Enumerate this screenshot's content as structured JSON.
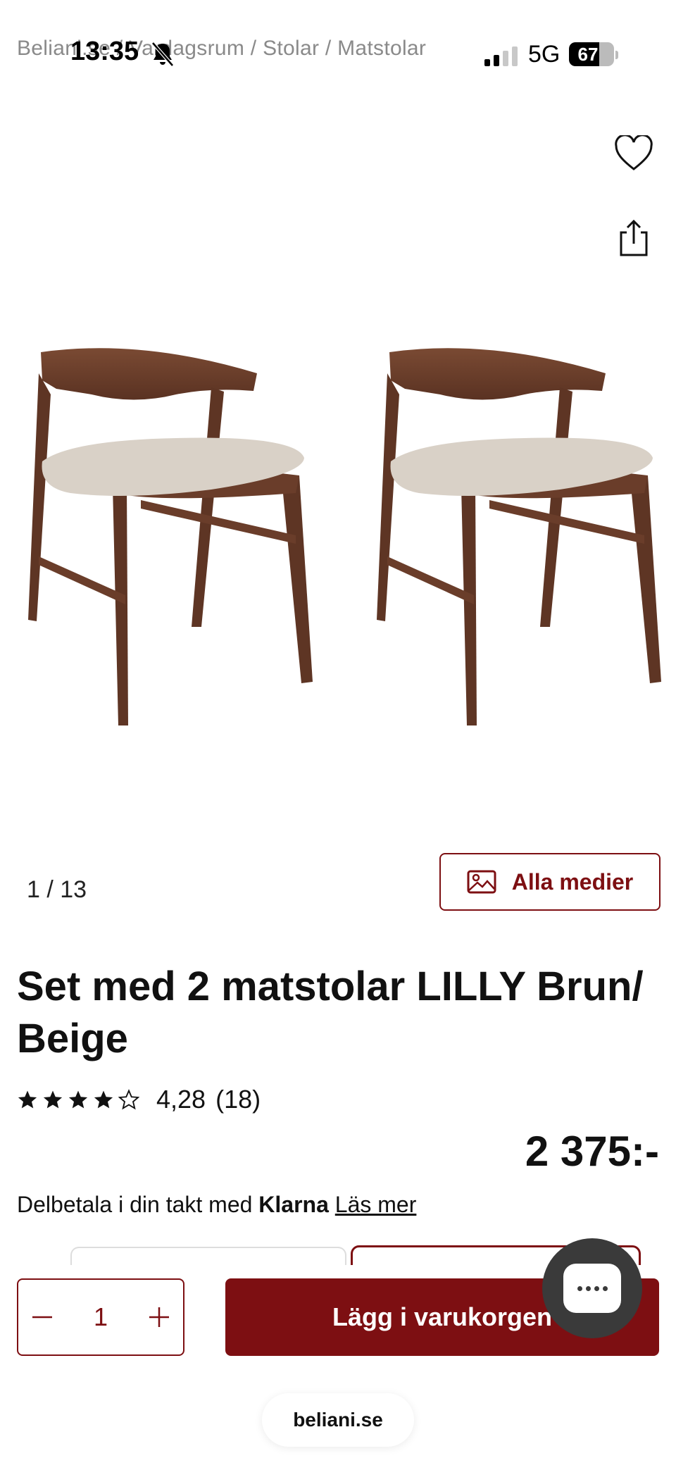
{
  "status": {
    "breadcrumb": "Beliani.se / Vardagsrum / Stolar / Matstolar",
    "time": "13:35",
    "network": "5G",
    "battery": "67"
  },
  "gallery": {
    "counter": "1 /  13",
    "all_media_label": "Alla medier"
  },
  "product": {
    "title": "Set med 2 matstolar LILLY Brun/ Beige",
    "rating_value": "4,28",
    "rating_count": "(18)",
    "rating_stars": 4.28,
    "price": "2 375:-"
  },
  "klarna": {
    "text": "Delbetala i din takt med ",
    "brand": "Klarna",
    "link": "Läs mer"
  },
  "cart": {
    "quantity": "1",
    "add_label": "Lägg i varukorgen"
  },
  "browser": {
    "url": "beliani.se"
  },
  "colors": {
    "accent": "#7d0f12",
    "chat_bg": "#3a3a3a"
  },
  "icons": [
    "heart-icon",
    "share-icon",
    "image-icon",
    "star-icon",
    "minus-icon",
    "plus-icon",
    "chat-icon",
    "bell-mute-icon",
    "signal-icon"
  ]
}
